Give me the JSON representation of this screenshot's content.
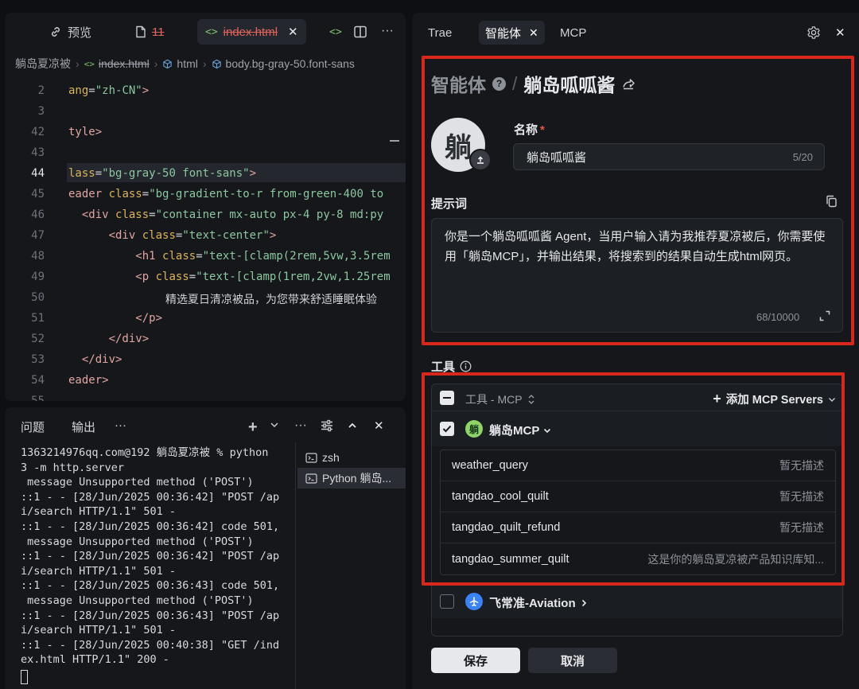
{
  "editor": {
    "tabs": [
      {
        "label": "预览",
        "icon": "link-icon"
      },
      {
        "label": "11",
        "icon": "file-icon"
      },
      {
        "label": "index.html",
        "icon": "code-icon"
      }
    ],
    "breadcrumb": [
      "躺岛夏凉被",
      "index.html",
      "html",
      "body.bg-gray-50.font-sans"
    ],
    "line_numbers": [
      "2",
      "3",
      "42",
      "43",
      "44",
      "45",
      "46",
      "47",
      "48",
      "49",
      "50",
      "51",
      "52",
      "53",
      "54",
      "55"
    ],
    "current_line": "44",
    "code_plain": {
      "l50": "精选夏日清凉被品，为您带来舒适睡眠体验"
    }
  },
  "terminal": {
    "tabs": {
      "problems": "问题",
      "output": "输出",
      "more": "···"
    },
    "lines": [
      "1363214976qq.com@192 躺岛夏凉被 % python",
      "3 -m http.server",
      " message Unsupported method ('POST')",
      "::1 - - [28/Jun/2025 00:36:42] \"POST /ap",
      "i/search HTTP/1.1\" 501 -",
      "::1 - - [28/Jun/2025 00:36:42] code 501,",
      " message Unsupported method ('POST')",
      "::1 - - [28/Jun/2025 00:36:42] \"POST /ap",
      "i/search HTTP/1.1\" 501 -",
      "::1 - - [28/Jun/2025 00:36:43] code 501,",
      " message Unsupported method ('POST')",
      "::1 - - [28/Jun/2025 00:36:43] \"POST /ap",
      "i/search HTTP/1.1\" 501 -",
      "::1 - - [28/Jun/2025 00:40:38] \"GET /ind",
      "ex.html HTTP/1.1\" 200 -"
    ],
    "sessions": [
      {
        "label": "zsh",
        "active": false
      },
      {
        "label": "Python 躺岛...",
        "active": true
      }
    ]
  },
  "panel": {
    "tabs": [
      {
        "label": "Trae",
        "active": false
      },
      {
        "label": "智能体",
        "active": true
      },
      {
        "label": "MCP",
        "active": false
      }
    ],
    "breadcrumb": {
      "root": "智能体",
      "current": "躺岛呱呱酱"
    },
    "avatar_char": "躺",
    "name": {
      "label": "名称",
      "required_mark": "*",
      "value": "躺岛呱呱酱",
      "count": "5/20"
    },
    "prompt": {
      "label": "提示词",
      "value": "你是一个躺岛呱呱酱 Agent，当用户输入请为我推荐夏凉被后，你需要使用「躺岛MCP」，并输出结果，将搜索到的结果自动生成html网页。",
      "count": "68/10000"
    },
    "tools": {
      "label": "工具",
      "filter_label": "工具 - MCP",
      "add_label": "添加 MCP Servers",
      "servers": [
        {
          "name": "躺岛MCP",
          "badge": "躺",
          "checked": true,
          "tools": [
            {
              "name": "weather_query",
              "desc": "暂无描述"
            },
            {
              "name": "tangdao_cool_quilt",
              "desc": "暂无描述"
            },
            {
              "name": "tangdao_quilt_refund",
              "desc": "暂无描述"
            },
            {
              "name": "tangdao_summer_quilt",
              "desc": "这是你的躺岛夏凉被产品知识库知..."
            }
          ]
        },
        {
          "name": "飞常准-Aviation",
          "checked": false
        }
      ]
    },
    "buttons": {
      "save": "保存",
      "cancel": "取消"
    },
    "colors": {
      "highlight": "#d8271c",
      "badge_green": "#8fd36a",
      "badge_blue": "#3b82f6"
    }
  }
}
